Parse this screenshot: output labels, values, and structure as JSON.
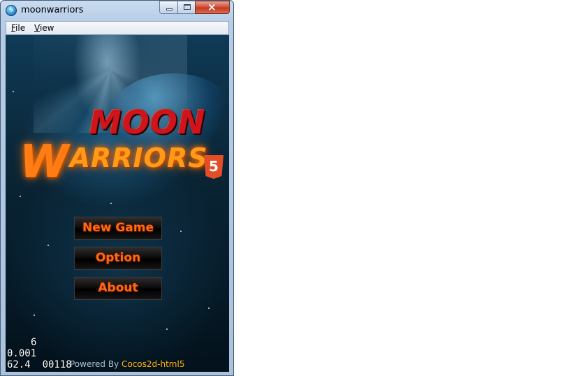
{
  "window": {
    "title": "moonwarriors",
    "icon": "app-icon",
    "controls": [
      "minimize-icon",
      "maximize-icon",
      "close-icon"
    ]
  },
  "menubar": {
    "items": [
      {
        "label": "File",
        "mnemonic": "F"
      },
      {
        "label": "View",
        "mnemonic": "V"
      }
    ]
  },
  "game": {
    "logo": {
      "line1": "MOON",
      "line2_initial": "W",
      "line2_rest": "ARRIORS",
      "badge": "5"
    },
    "menu": {
      "new_game": "New Game",
      "option": "Option",
      "about": "About"
    },
    "footer": {
      "powered_prefix": "Powered By ",
      "powered_brand": "Cocos2d-html5"
    },
    "debug_stats": {
      "draw_calls": "6",
      "frame_time": "0.001",
      "fps_line": "62.4  00118"
    }
  },
  "colors": {
    "button_text": "#ff6a12",
    "logo_red": "#d0141b",
    "logo_orange": "#ff9a1a",
    "brand_yellow": "#ffb400"
  }
}
